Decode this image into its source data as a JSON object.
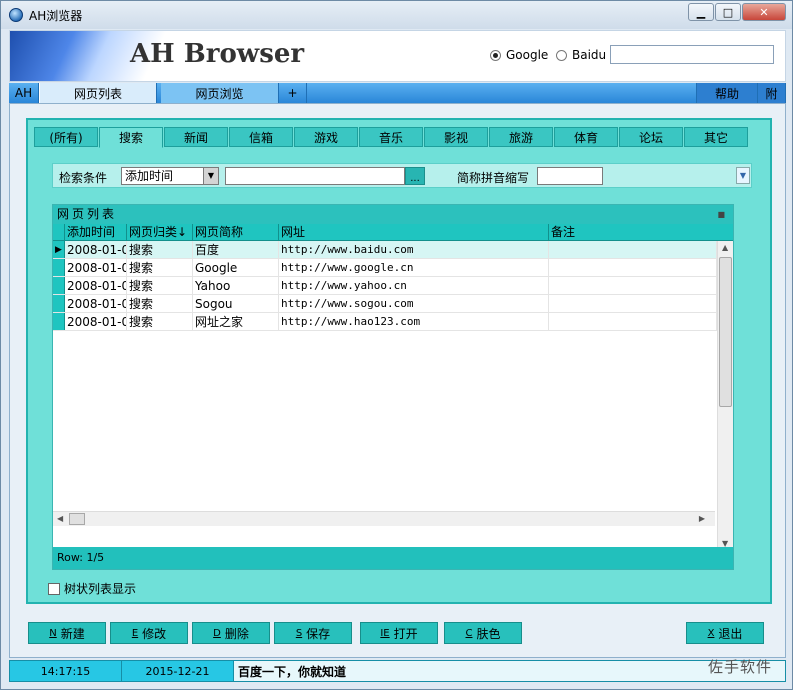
{
  "window": {
    "title": "AH浏览器",
    "min": "0",
    "max": "□",
    "close": "✕"
  },
  "banner": {
    "title": "AH Browser",
    "engines": [
      {
        "label": "Google",
        "selected": true
      },
      {
        "label": "Baidu",
        "selected": false
      }
    ],
    "search_value": ""
  },
  "menubar": {
    "tabs": [
      "AH",
      "网页列表",
      "网页浏览",
      "+"
    ],
    "help": "帮助",
    "extra": "附"
  },
  "categories": [
    "(所有)",
    "搜索",
    "新闻",
    "信箱",
    "游戏",
    "音乐",
    "影视",
    "旅游",
    "体育",
    "论坛",
    "其它"
  ],
  "filter": {
    "condition_label": "检索条件",
    "condition_value": "添加时间",
    "condition_input": "",
    "dots": "...",
    "abbr_label": "简称拼音缩写",
    "abbr_value": ""
  },
  "grid": {
    "caption": "网页列表",
    "columns": [
      "添加时间",
      "网页归类",
      "网页简称",
      "网址",
      "备注"
    ],
    "rows": [
      [
        "2008-01-0",
        "搜索",
        "百度",
        "http://www.baidu.com",
        ""
      ],
      [
        "2008-01-0",
        "搜索",
        "Google",
        "http://www.google.cn",
        ""
      ],
      [
        "2008-01-0",
        "搜索",
        "Yahoo",
        "http://www.yahoo.cn",
        ""
      ],
      [
        "2008-01-0",
        "搜索",
        "Sogou",
        "http://www.sogou.com",
        ""
      ],
      [
        "2008-01-0",
        "搜索",
        "网址之家",
        "http://www.hao123.com",
        ""
      ]
    ],
    "status": "Row: 1/5"
  },
  "tree_option": "树状列表显示",
  "actions": [
    {
      "key": "N",
      "label": "新建"
    },
    {
      "key": "E",
      "label": "修改"
    },
    {
      "key": "D",
      "label": "删除"
    },
    {
      "key": "S",
      "label": "保存"
    },
    {
      "key": "IE",
      "label": "打开"
    },
    {
      "key": "C",
      "label": "肤色"
    },
    {
      "key": "X",
      "label": "退出"
    }
  ],
  "statusbar": {
    "time": "14:17:15",
    "date": "2015-12-21",
    "message": "百度一下，你就知道"
  },
  "watermark": "佐手软件"
}
